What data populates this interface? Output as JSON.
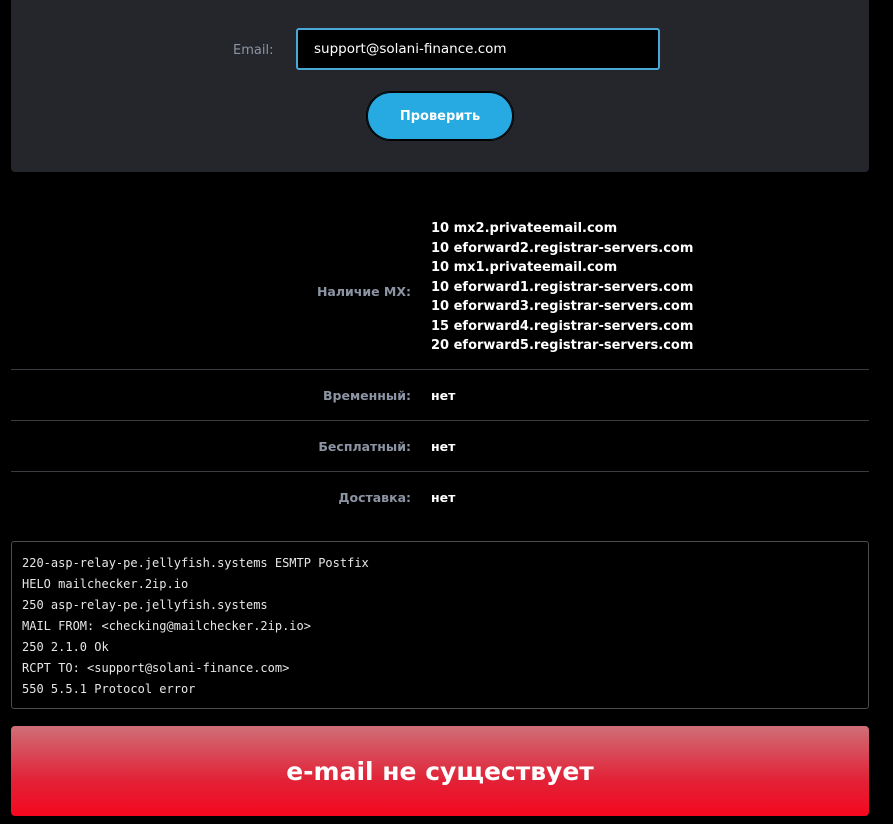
{
  "form": {
    "email_label": "Email:",
    "email_value": "support@solani-finance.com",
    "check_button": "Проверить"
  },
  "results": {
    "mx_label": "Наличие MX:",
    "mx_records": [
      "10 mx2.privateemail.com",
      "10 eforward2.registrar-servers.com",
      "10 mx1.privateemail.com",
      "10 eforward1.registrar-servers.com",
      "10 eforward3.registrar-servers.com",
      "15 eforward4.registrar-servers.com",
      "20 eforward5.registrar-servers.com"
    ],
    "temporary_label": "Временный:",
    "temporary_value": "нет",
    "free_label": "Бесплатный:",
    "free_value": "нет",
    "delivery_label": "Доставка:",
    "delivery_value": "нет"
  },
  "smtp_log": [
    "220-asp-relay-pe.jellyfish.systems ESMTP Postfix",
    "HELO mailchecker.2ip.io",
    "250 asp-relay-pe.jellyfish.systems",
    "MAIL FROM: <checking@mailchecker.2ip.io>",
    "250 2.1.0 Ok",
    "RCPT TO: <support@solani-finance.com>",
    "550 5.5.1 Protocol error"
  ],
  "verdict": "e-mail не существует",
  "colors": {
    "accent": "#27a9e1",
    "danger": "#f5081f",
    "panel": "#24262b"
  }
}
